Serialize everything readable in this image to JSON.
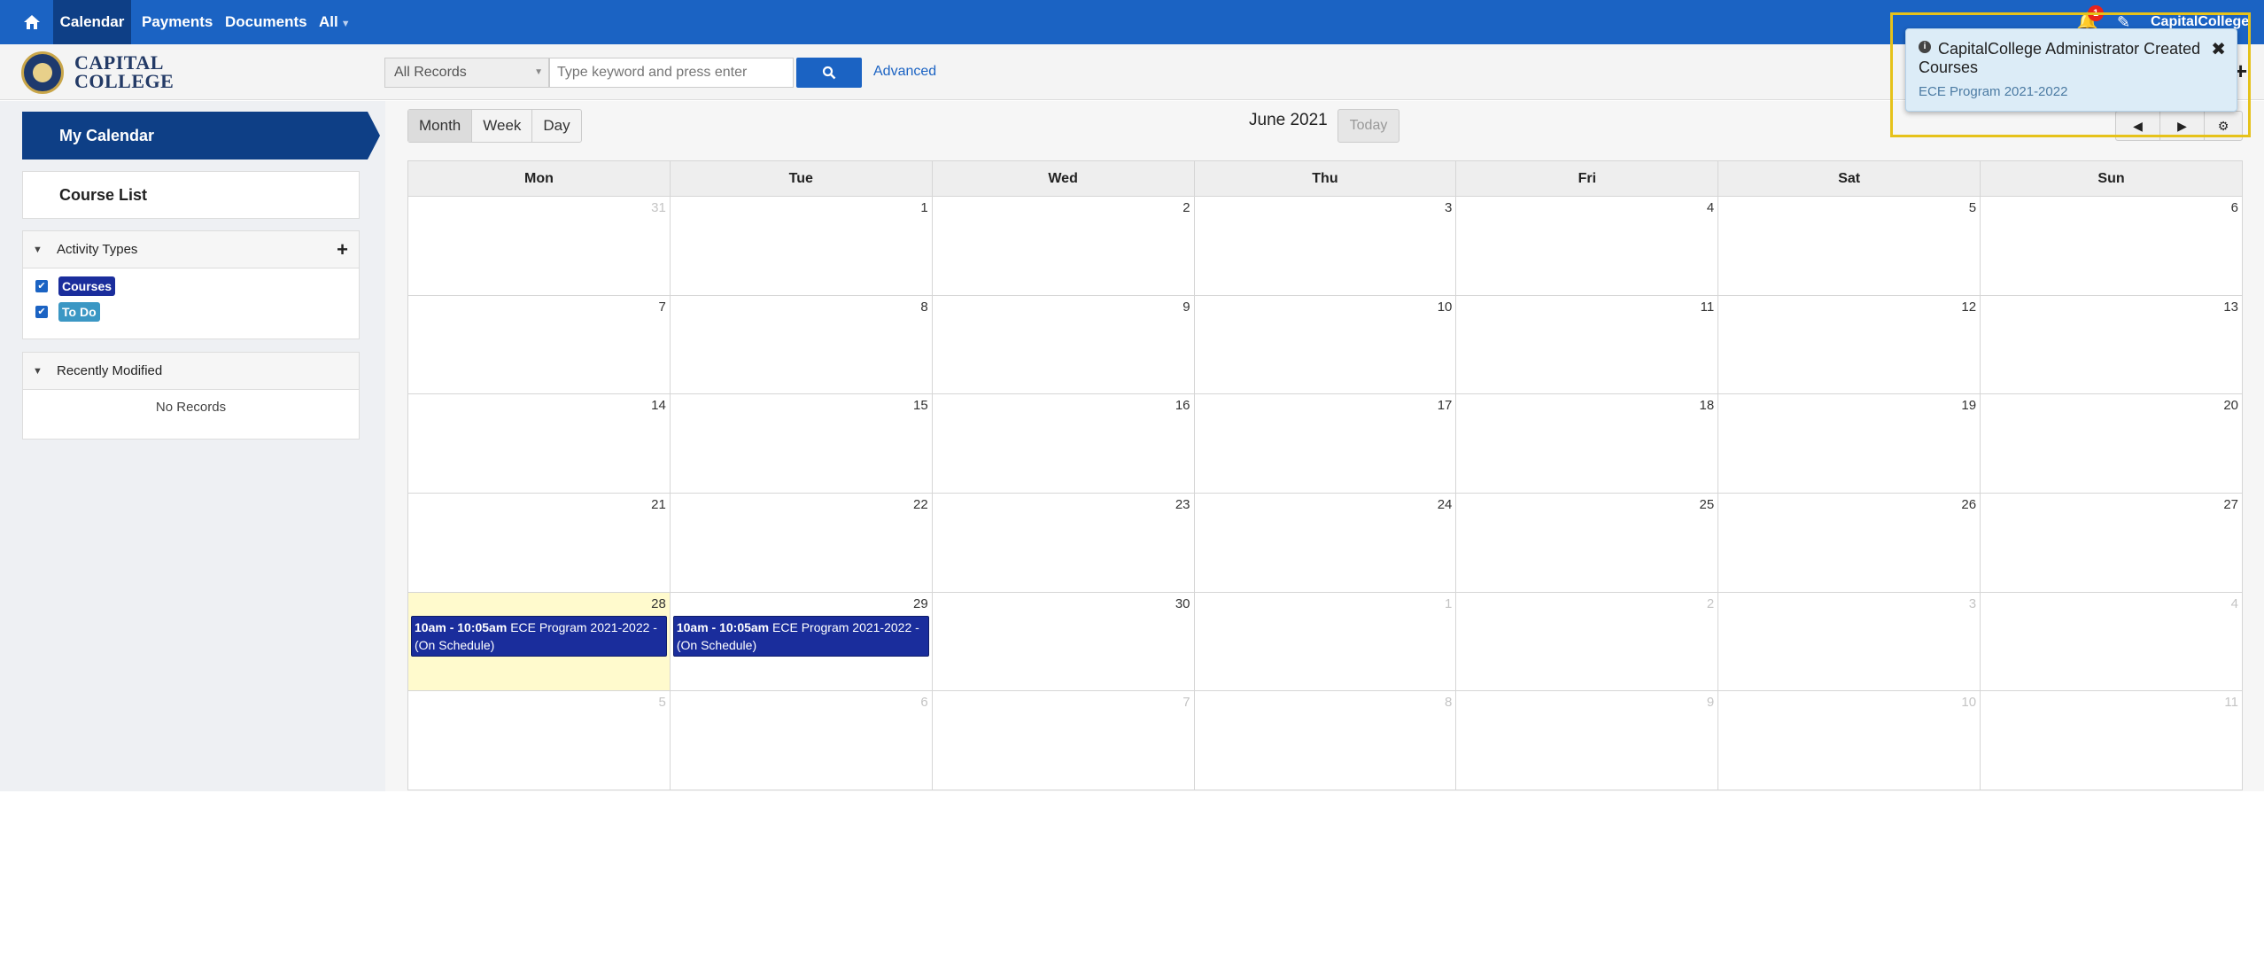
{
  "topnav": {
    "home_icon": "home-icon",
    "items": [
      {
        "label": "Calendar",
        "active": true
      },
      {
        "label": "Payments"
      },
      {
        "label": "Documents"
      },
      {
        "label": "All"
      }
    ],
    "notification_count": "1",
    "user": "CapitalCollege"
  },
  "header": {
    "logo_line1": "CAPITAL",
    "logo_line2": "COLLEGE",
    "record_select": "All Records",
    "search_placeholder": "Type keyword and press enter",
    "advanced": "Advanced"
  },
  "sidebar": {
    "my_calendar": "My Calendar",
    "course_list": "Course List",
    "activity_types": {
      "title": "Activity Types",
      "items": [
        {
          "label": "Courses",
          "checked": true,
          "color": "#1a2d9c"
        },
        {
          "label": "To Do",
          "checked": true,
          "color": "#3b97c4"
        }
      ]
    },
    "recently_modified": {
      "title": "Recently Modified",
      "empty": "No Records"
    }
  },
  "calendar": {
    "views": [
      "Month",
      "Week",
      "Day"
    ],
    "active_view": "Month",
    "title": "June 2021",
    "today_label": "Today",
    "weekdays": [
      "Mon",
      "Tue",
      "Wed",
      "Thu",
      "Fri",
      "Sat",
      "Sun"
    ],
    "weeks": [
      [
        "31",
        "1",
        "2",
        "3",
        "4",
        "5",
        "6"
      ],
      [
        "7",
        "8",
        "9",
        "10",
        "11",
        "12",
        "13"
      ],
      [
        "14",
        "15",
        "16",
        "17",
        "18",
        "19",
        "20"
      ],
      [
        "21",
        "22",
        "23",
        "24",
        "25",
        "26",
        "27"
      ],
      [
        "28",
        "29",
        "30",
        "1",
        "2",
        "3",
        "4"
      ],
      [
        "5",
        "6",
        "7",
        "8",
        "9",
        "10",
        "11"
      ]
    ],
    "events": [
      {
        "time": "10am - 10:05am",
        "title": "ECE Program 2021-2022 - (On Schedule)"
      },
      {
        "time": "10am - 10:05am",
        "title": "ECE Program 2021-2022 - (On Schedule)"
      }
    ]
  },
  "toast": {
    "title": "CapitalCollege Administrator Created Courses",
    "subtitle": "ECE Program 2021-2022"
  }
}
